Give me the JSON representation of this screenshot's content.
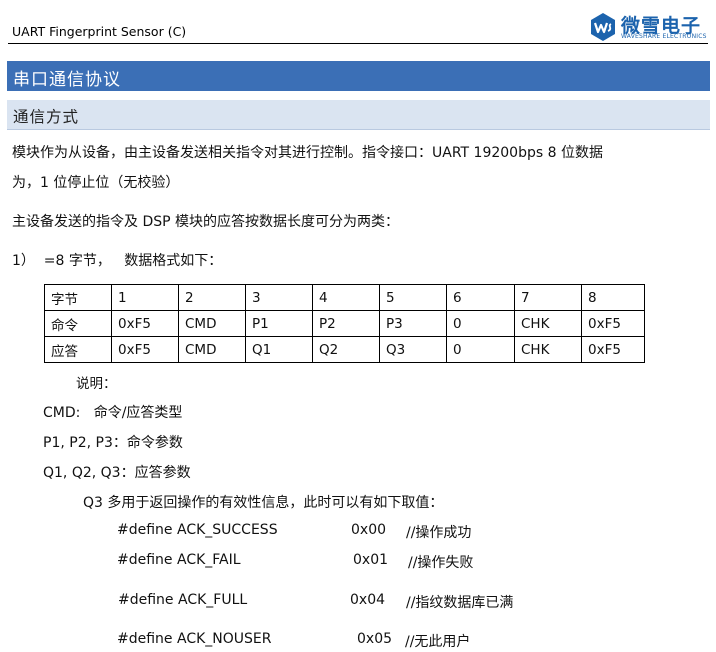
{
  "header": {
    "title": "UART Fingerprint Sensor (C)"
  },
  "logo": {
    "cn": "微雪电子",
    "en": "WAVESHARE ELECTRONICS"
  },
  "heading1": "串口通信协议",
  "heading2": "通信方式",
  "para1_line1": "模块作为从设备，由主设备发送相关指令对其进行控制。指令接口：UART 19200bps 8 位数据",
  "para1_line2": "为，1 位停止位（无校验）",
  "para2": "主设备发送的指令及 DSP 模块的应答按数据长度可分为两类：",
  "item1": "1）  =8 字节，   数据格式如下：",
  "table": {
    "rows": [
      [
        "字节",
        "1",
        "2",
        "3",
        "4",
        "5",
        "6",
        "7",
        "8"
      ],
      [
        "命令",
        "0xF5",
        "CMD",
        "P1",
        "P2",
        "P3",
        "0",
        "CHK",
        "0xF5"
      ],
      [
        "应答",
        "0xF5",
        "CMD",
        "Q1",
        "Q2",
        "Q3",
        "0",
        "CHK",
        "0xF5"
      ]
    ]
  },
  "notes": {
    "title": "说明：",
    "cmd": "CMD:   命令/应答类型",
    "p": "P1, P2, P3：命令参数",
    "q": "Q1, Q2, Q3：应答参数",
    "q3": "Q3 多用于返回操作的有效性信息，此时可以有如下取值："
  },
  "defines": [
    {
      "name": "#define ACK_SUCCESS",
      "value": "0x00",
      "comment": "//操作成功"
    },
    {
      "name": "#define ACK_FAIL",
      "value": "0x01",
      "comment": "//操作失败"
    },
    {
      "name": "#define ACK_FULL",
      "value": "0x04",
      "comment": "//指纹数据库已满"
    },
    {
      "name": "#define ACK_NOUSER",
      "value": "0x05",
      "comment": "//无此用户"
    }
  ]
}
